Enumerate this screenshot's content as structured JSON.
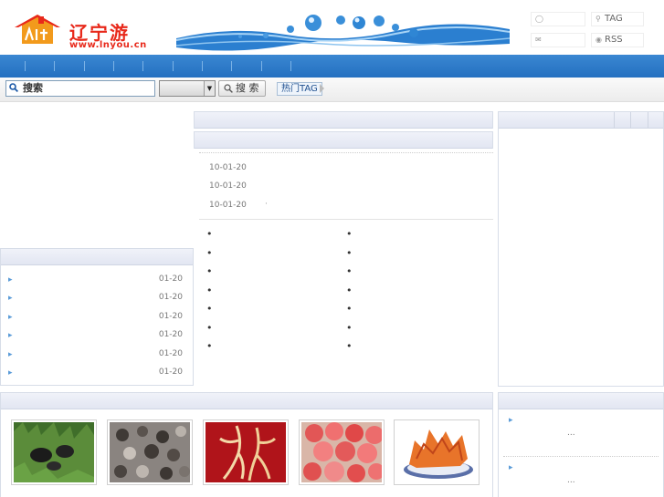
{
  "header": {
    "logo_text": "辽宁游",
    "logo_url": "www.lnyou.cn",
    "tag_label": "TAG",
    "rss_label": "RSS"
  },
  "search": {
    "button_label": "搜 索",
    "input_value": "搜索",
    "hot_tag_label": "热门TAG"
  },
  "news": {
    "dates": [
      "10-01-20",
      "10-01-20",
      "10-01-20"
    ],
    "third_suffix": "·"
  },
  "left_list": {
    "items": [
      "01-20",
      "01-20",
      "01-20",
      "01-20",
      "01-20",
      "01-20"
    ]
  },
  "bullet_columns": {
    "left": [
      "•",
      "•",
      "•",
      "•",
      "•",
      "•",
      "•"
    ],
    "right": [
      "•",
      "•",
      "•",
      "•",
      "•",
      "•",
      "•"
    ]
  },
  "photos": [
    {
      "icon": "mushroom-photo"
    },
    {
      "icon": "crabs-photo"
    },
    {
      "icon": "ginseng-photo"
    },
    {
      "icon": "apples-photo"
    },
    {
      "icon": "fried-dish-photo"
    }
  ],
  "right_list": {
    "ellipsis": [
      "...",
      "..."
    ]
  },
  "colors": {
    "nav_blue": "#2470c0",
    "logo_red": "#e8291b",
    "panel_head": "#e2e6f2",
    "bullet_blue": "#5a9bd8"
  }
}
